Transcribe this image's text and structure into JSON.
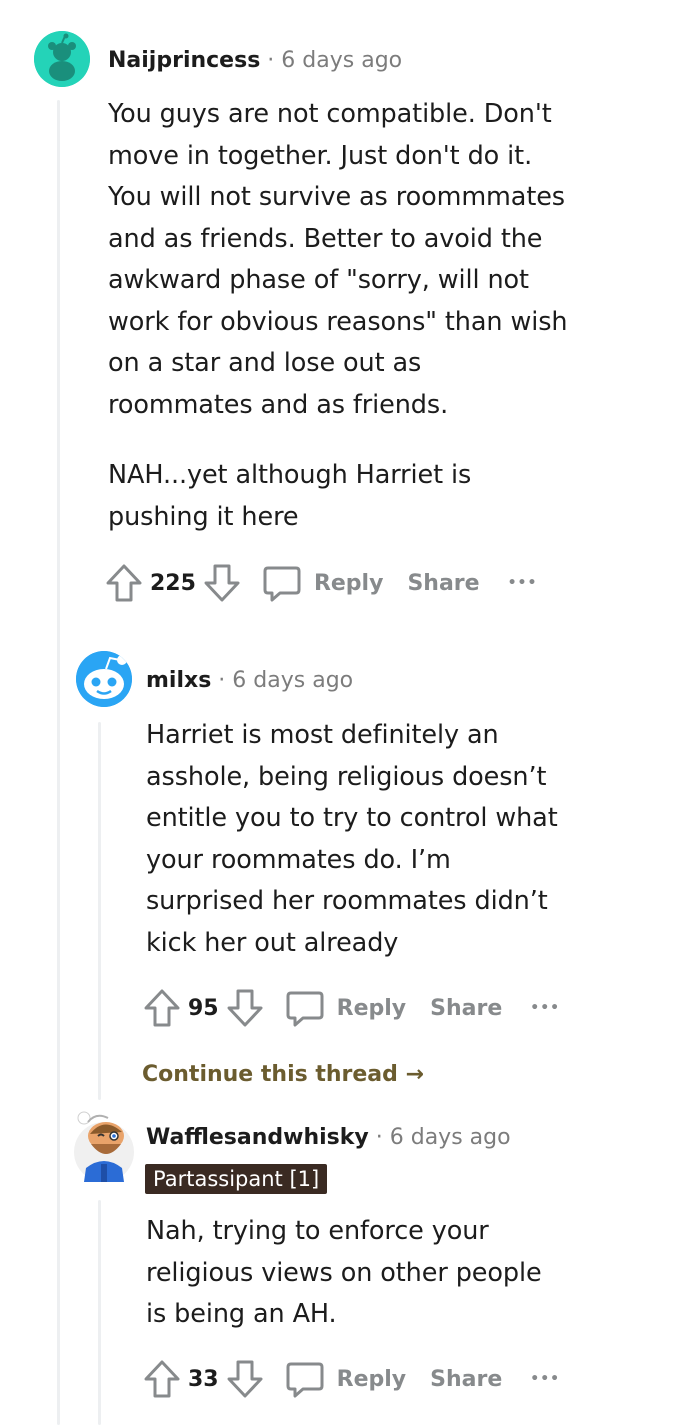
{
  "comments": [
    {
      "author": "Naijprincess",
      "separator": "·",
      "time": "6 days ago",
      "body": "You guys are not compatible. Don't\nmove in together. Just don't do it.\nYou will not survive as roommmates\nand as friends. Better to avoid the\nawkward phase of \"sorry, will not\nwork for obvious reasons\" than wish\non a star and lose out as\nroommates and as friends.",
      "body2": "NAH...yet although Harriet is\npushing it here",
      "votes": "225",
      "reply_label": "Reply",
      "share_label": "Share",
      "more_label": "•••"
    },
    {
      "author": "milxs",
      "separator": "·",
      "time": "6 days ago",
      "body": "Harriet is most definitely an\nasshole, being religious doesn’t\nentitle you to try to control what\nyour roommates do. I’m\nsurprised her roommates didn’t\nkick her out already",
      "votes": "95",
      "reply_label": "Reply",
      "share_label": "Share",
      "more_label": "•••",
      "continue_label": "Continue this thread →"
    },
    {
      "author": "Wafflesandwhisky",
      "separator": "·",
      "time": "6 days ago",
      "flair": "Partassipant [1]",
      "body": "Nah, trying to enforce your\nreligious views on other people\nis being an AH.",
      "votes": "33",
      "reply_label": "Reply",
      "share_label": "Share",
      "more_label": "•••"
    }
  ],
  "colors": {
    "avatar_teal": "#24d3b8",
    "avatar_blue": "#2aa5f4",
    "flair_bg": "#3a2a22",
    "continue_link": "#6b5c2f",
    "meta_gray": "#7c7c7c",
    "action_gray": "#878a8c"
  }
}
